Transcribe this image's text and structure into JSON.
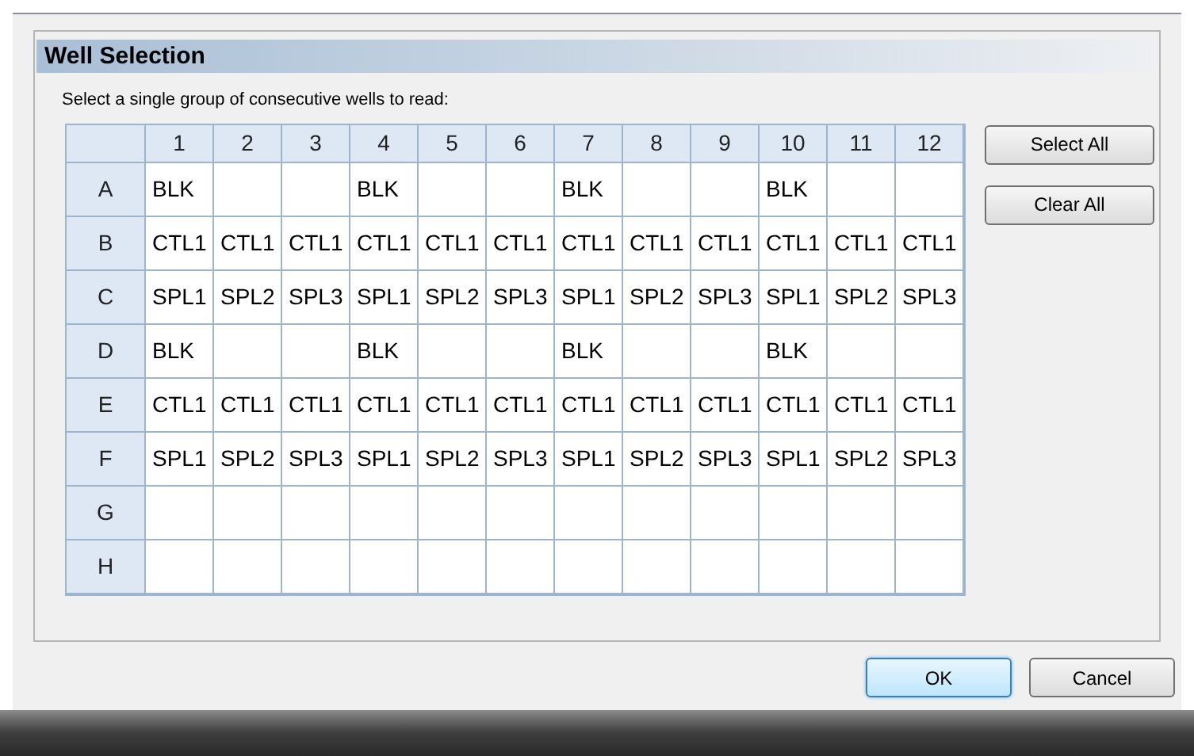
{
  "group": {
    "title": "Well Selection"
  },
  "instruction": "Select a single group of consecutive wells to read:",
  "plate": {
    "columns": [
      "1",
      "2",
      "3",
      "4",
      "5",
      "6",
      "7",
      "8",
      "9",
      "10",
      "11",
      "12"
    ],
    "rows": [
      {
        "label": "A",
        "cells": [
          "BLK",
          null,
          null,
          "BLK",
          null,
          null,
          "BLK",
          null,
          null,
          "BLK",
          null,
          null
        ]
      },
      {
        "label": "B",
        "cells": [
          "CTL1",
          "CTL1",
          "CTL1",
          "CTL1",
          "CTL1",
          "CTL1",
          "CTL1",
          "CTL1",
          "CTL1",
          "CTL1",
          "CTL1",
          "CTL1"
        ]
      },
      {
        "label": "C",
        "cells": [
          "SPL1",
          "SPL2",
          "SPL3",
          "SPL1",
          "SPL2",
          "SPL3",
          "SPL1",
          "SPL2",
          "SPL3",
          "SPL1",
          "SPL2",
          "SPL3"
        ]
      },
      {
        "label": "D",
        "cells": [
          "BLK",
          null,
          null,
          "BLK",
          null,
          null,
          "BLK",
          null,
          null,
          "BLK",
          null,
          null
        ]
      },
      {
        "label": "E",
        "cells": [
          "CTL1",
          "CTL1",
          "CTL1",
          "CTL1",
          "CTL1",
          "CTL1",
          "CTL1",
          "CTL1",
          "CTL1",
          "CTL1",
          "CTL1",
          "CTL1"
        ]
      },
      {
        "label": "F",
        "cells": [
          "SPL1",
          "SPL2",
          "SPL3",
          "SPL1",
          "SPL2",
          "SPL3",
          "SPL1",
          "SPL2",
          "SPL3",
          "SPL1",
          "SPL2",
          "SPL3"
        ]
      },
      {
        "label": "G",
        "cells": [
          null,
          null,
          null,
          null,
          null,
          null,
          null,
          null,
          null,
          null,
          null,
          null
        ]
      },
      {
        "label": "H",
        "cells": [
          null,
          null,
          null,
          null,
          null,
          null,
          null,
          null,
          null,
          null,
          null,
          null
        ]
      }
    ]
  },
  "side_buttons": [
    "Select All",
    "Clear All"
  ],
  "footer_buttons": [
    {
      "label": "OK",
      "default": true
    },
    {
      "label": "Cancel",
      "default": false
    }
  ]
}
